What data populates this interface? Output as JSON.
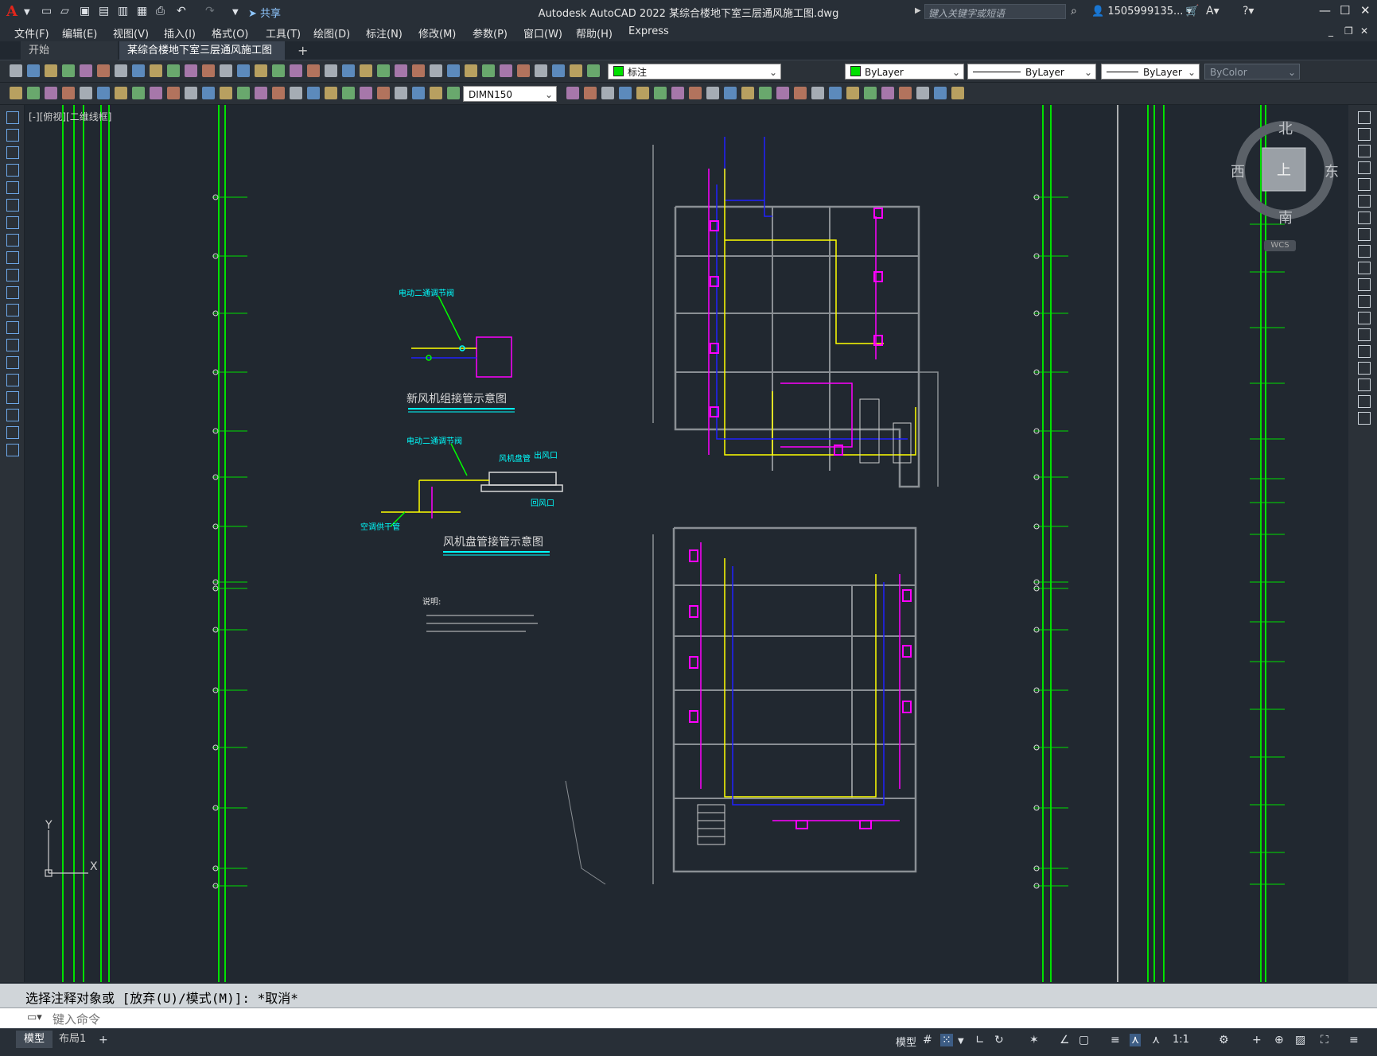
{
  "app": {
    "logo": "A",
    "title": "Autodesk AutoCAD 2022    某综合楼地下室三层通风施工图.dwg",
    "share_label": "共享",
    "search_placeholder": "键入关键字或短语",
    "user": "1505999135...",
    "quick_access_icons": [
      "new-icon",
      "open-icon",
      "save-icon",
      "saveas-icon",
      "plot-icon",
      "print-icon",
      "undo-icon",
      "redo-icon",
      "dropdown-icon"
    ],
    "window_controls": {
      "minimize": "—",
      "maximize": "☐",
      "close": "✕"
    }
  },
  "menubar": [
    "文件(F)",
    "编辑(E)",
    "视图(V)",
    "插入(I)",
    "格式(O)",
    "工具(T)",
    "绘图(D)",
    "标注(N)",
    "修改(M)",
    "参数(P)",
    "窗口(W)",
    "帮助(H)",
    "Express"
  ],
  "tabs": [
    {
      "label": "开始",
      "active": false
    },
    {
      "label": "某综合楼地下室三层通风施工图*",
      "active": true
    }
  ],
  "tab_close": "✕",
  "tab_add": "+",
  "toolbar": {
    "layer_name": "标注",
    "color": "ByLayer",
    "linetype": "ByLayer",
    "lineweight": "ByLayer",
    "plotstyle": "ByColor",
    "dimstyle": "DIMN150"
  },
  "viewport": {
    "label": "[-][俯视][二维线框]",
    "viewcube": {
      "north": "北",
      "south": "南",
      "east": "东",
      "west": "西",
      "face": "上",
      "wcs": "WCS"
    },
    "ucs": {
      "x": "X",
      "y": "Y"
    }
  },
  "drawing": {
    "caption1": "新风机组接管示意图",
    "caption2": "风机盘管接管示意图",
    "label_valve1": "电动二通调节阀",
    "label_valve2": "电动二通调节阀",
    "label_fcu": "风机盘管",
    "label_outlet": "出风口",
    "label_return": "回风口",
    "label_main": "空调供干管",
    "notes_title": "说明:"
  },
  "command": {
    "history": "选择注释对象或 [放弃(U)/模式(M)]: *取消*",
    "placeholder": "键入命令"
  },
  "statusbar": {
    "tabs": [
      {
        "label": "模型",
        "active": true
      },
      {
        "label": "布局1",
        "active": false
      }
    ],
    "add": "+",
    "model_label": "模型",
    "scale": "1:1"
  },
  "colors": {
    "background": "#212830",
    "grid_green": "#00e000",
    "duct_magenta": "#ff00ff",
    "pipe_yellow": "#ffff00",
    "pipe_blue": "#2020ff",
    "caption_cyan": "#00ffff",
    "wall_gray": "#8a8f94"
  }
}
